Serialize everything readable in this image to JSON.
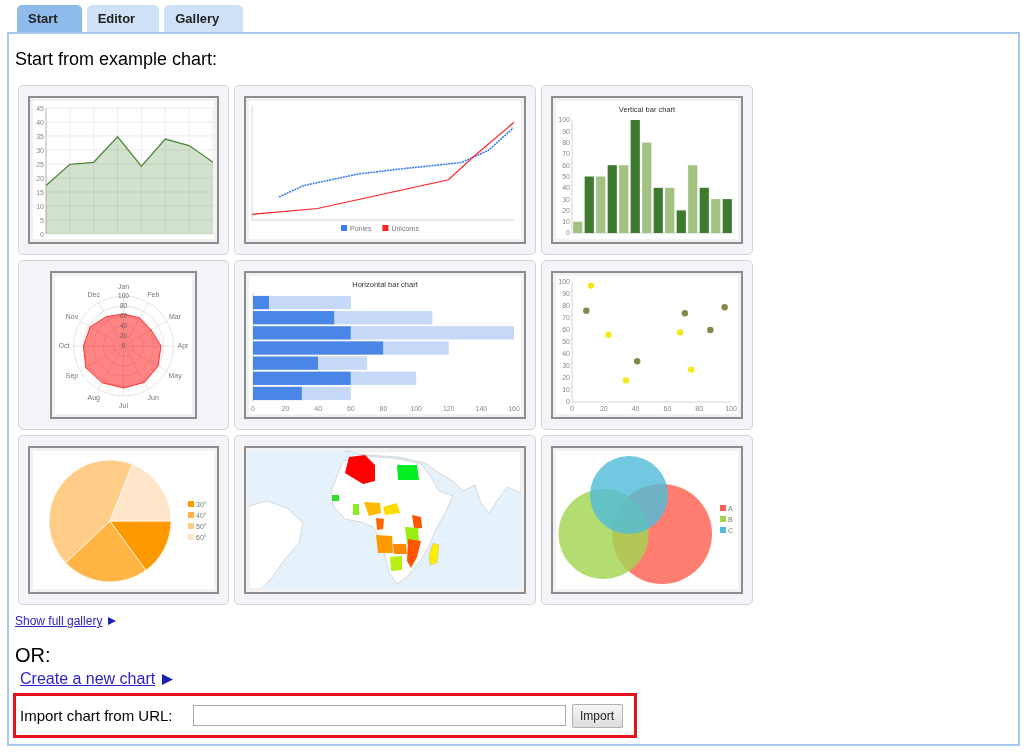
{
  "tabs": [
    {
      "label": "Start",
      "selected": true
    },
    {
      "label": "Editor",
      "selected": false
    },
    {
      "label": "Gallery",
      "selected": false
    }
  ],
  "heading": "Start from example chart:",
  "examples": [
    {
      "kind": "chart",
      "chart_data": {
        "type": "area",
        "grid": true,
        "series": [
          {
            "color": "#4f8a3c",
            "values": [
              17.3,
              24.9,
              25.6,
              34.7,
              24.2,
              33.9,
              31.6,
              25.6
            ]
          }
        ],
        "ylim": [
          0,
          45
        ],
        "yticks": [
          0,
          5,
          10,
          15,
          20,
          25,
          30,
          35,
          40,
          45
        ]
      }
    },
    {
      "kind": "sketch",
      "legend": [
        {
          "label": "Ponies",
          "color": "#3d7cf0"
        },
        {
          "label": "Unicorns",
          "color": "#ff2222"
        }
      ]
    },
    {
      "kind": "chart",
      "chart_data": {
        "type": "bar",
        "title": "Vertical bar chart",
        "orientation": "vertical",
        "stacked": false,
        "series": [
          {
            "color": "#a3c182",
            "values": [
              10,
              50,
              60,
              80,
              40,
              60,
              30
            ]
          },
          {
            "color": "#3e7a2e",
            "values": [
              50,
              60,
              100,
              40,
              20,
              40,
              30
            ]
          }
        ],
        "ylim": [
          0,
          100
        ],
        "yticks": [
          0,
          10,
          20,
          30,
          40,
          50,
          60,
          70,
          80,
          90,
          100
        ]
      }
    },
    {
      "kind": "radar",
      "spoke_labels": [
        "Jan",
        "Feb",
        "Mar",
        "Apr",
        "May",
        "Jun",
        "Jul",
        "Aug",
        "Sep",
        "Oct",
        "Nov",
        "Dec"
      ],
      "ring_labels": [
        "100",
        "80",
        "60",
        "40",
        "20",
        "0"
      ]
    },
    {
      "kind": "chart",
      "chart_data": {
        "type": "bar",
        "title": "Horizontal bar chart",
        "orientation": "horizontal",
        "stacked": true,
        "series": [
          {
            "color": "#4a86e8",
            "values": [
              10,
              50,
              60,
              80,
              40,
              60,
              30
            ]
          },
          {
            "color": "#c6d9f8",
            "values": [
              50,
              60,
              100,
              40,
              30,
              40,
              30
            ]
          }
        ],
        "xlim": [
          0,
          160
        ],
        "xticks": [
          0,
          20,
          40,
          60,
          80,
          100,
          120,
          140,
          160
        ]
      }
    },
    {
      "kind": "chart",
      "chart_data": {
        "type": "scatter",
        "x": [
          9,
          12,
          23,
          34,
          41,
          68,
          71,
          75,
          87,
          96
        ],
        "series": [
          {
            "color": "#f4e81a",
            "values": [
              null,
              97,
              56,
              18,
              null,
              58,
              null,
              27,
              null,
              null
            ]
          },
          {
            "color": "#87874b",
            "values": [
              76,
              null,
              null,
              null,
              34,
              null,
              74,
              null,
              60,
              79
            ]
          }
        ],
        "xlim": [
          0,
          100
        ],
        "ylim": [
          0,
          100
        ],
        "xticks": [
          0,
          20,
          40,
          60,
          80,
          100
        ],
        "yticks": [
          0,
          10,
          20,
          30,
          40,
          50,
          60,
          70,
          80,
          90,
          100
        ]
      }
    },
    {
      "kind": "chart",
      "chart_data": {
        "type": "pie",
        "categories": [
          "30°",
          "40°",
          "50°",
          "60°"
        ],
        "values": [
          15,
          23,
          43,
          19
        ],
        "colors": [
          "#ff9900",
          "#ffb444",
          "#ffcd88",
          "#ffe6c8"
        ],
        "legend": "right"
      }
    },
    {
      "kind": "map"
    },
    {
      "kind": "venn",
      "legend": [
        {
          "label": "A",
          "color": "#ff6152"
        },
        {
          "label": "B",
          "color": "#a2d652"
        },
        {
          "label": "C",
          "color": "#52bcd8"
        }
      ]
    }
  ],
  "gallery_link": "Show full gallery",
  "or_label": "OR:",
  "create_link": "Create a new chart",
  "import": {
    "label": "Import chart from URL:",
    "button": "Import",
    "highlighted": true
  }
}
